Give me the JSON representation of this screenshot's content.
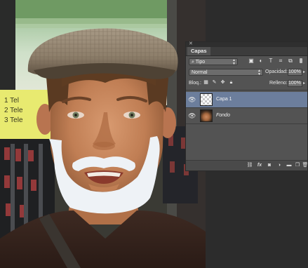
{
  "layers_panel": {
    "tab_label": "Capas",
    "filter_kind": "Tipo",
    "blend_mode": "Normal",
    "opacity_label": "Opacidad:",
    "opacity_value": "100%",
    "lock_label": "Bloq.:",
    "fill_label": "Relleno:",
    "fill_value": "100%",
    "layers": [
      {
        "name": "Capa 1",
        "selected": true,
        "thumbnail": "transparent"
      },
      {
        "name": "Fondo",
        "selected": false,
        "thumbnail": "photo"
      }
    ],
    "bottom_icons": [
      "link-icon",
      "fx-icon",
      "mask-icon",
      "adjustment-icon",
      "group-folder-icon",
      "new-layer-icon",
      "trash-icon"
    ],
    "fx_label": "fx"
  },
  "canvas": {
    "sign_text_lines": [
      "1 Tel",
      "2 Tele",
      "3 Tele"
    ]
  },
  "colors": {
    "panel_bg": "#535353",
    "selected_row": "#6c7e9c",
    "workspace": "#282828"
  }
}
